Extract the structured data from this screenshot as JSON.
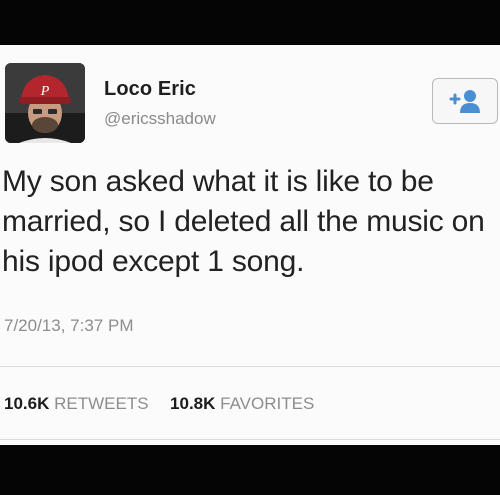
{
  "user": {
    "display_name": "Loco Eric",
    "handle": "@ericsshadow"
  },
  "tweet": {
    "text": "My son asked what it is like to be married, so I deleted all the music on his ipod except 1 song.",
    "timestamp": "7/20/13, 7:37 PM"
  },
  "stats": {
    "retweets_count": "10.6K",
    "retweets_label": "RETWEETS",
    "favorites_count": "10.8K",
    "favorites_label": "FAVORITES"
  },
  "icons": {
    "follow": "add-user-icon",
    "avatar": "avatar"
  },
  "colors": {
    "follow_icon": "#4a8fd1",
    "text": "#222222",
    "muted": "#8d8d8d",
    "cap": "#b3262e"
  }
}
